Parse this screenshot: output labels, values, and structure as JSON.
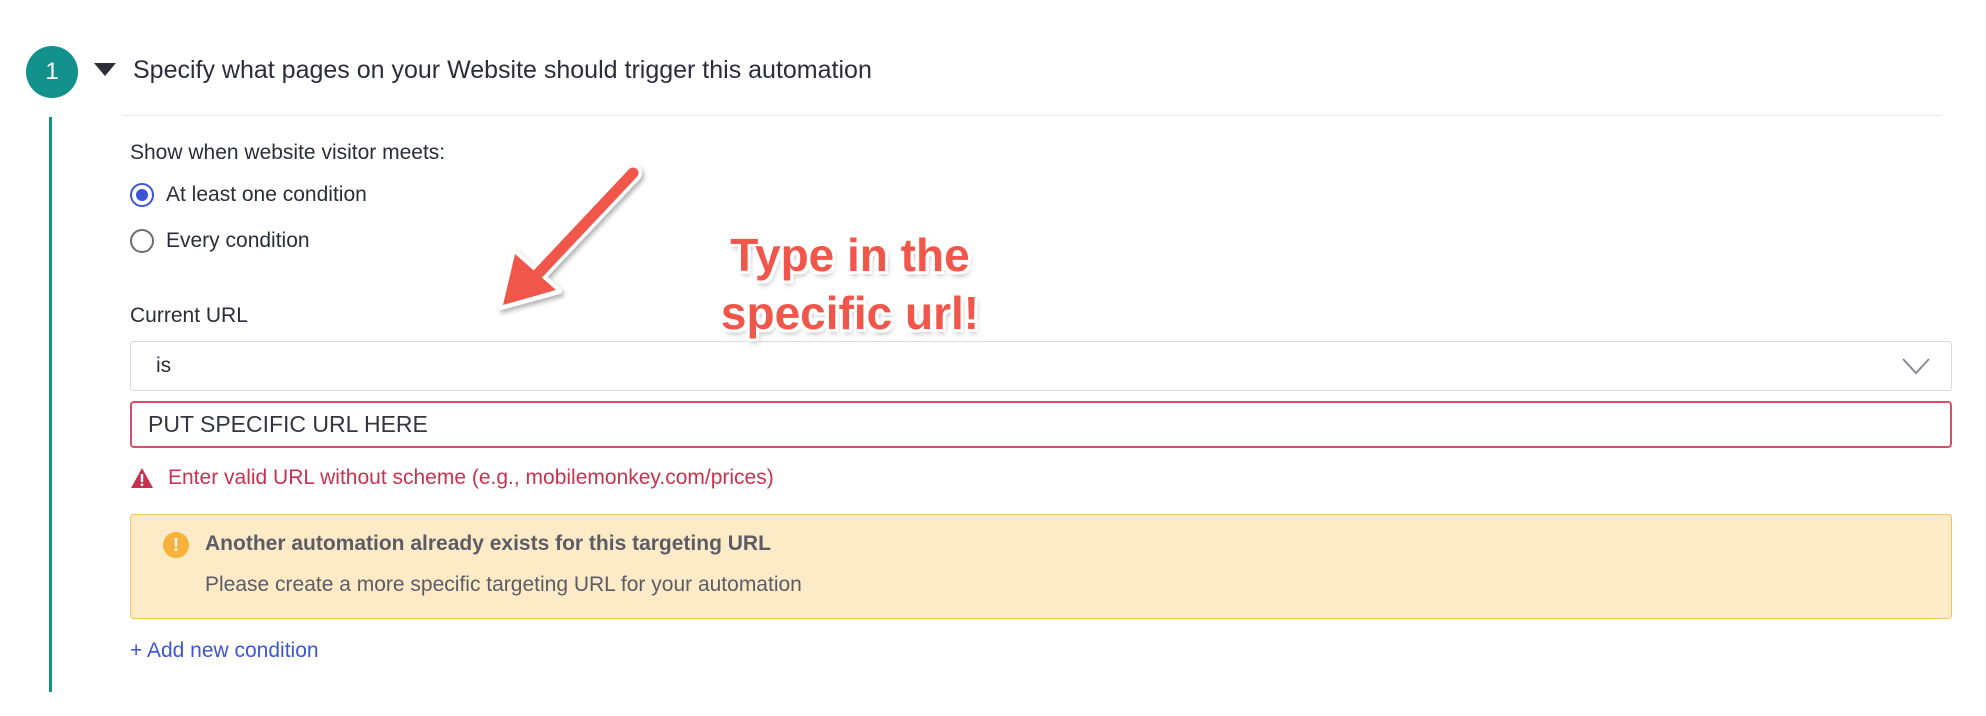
{
  "step": {
    "number": "1",
    "title": "Specify what pages on your Website should trigger this automation"
  },
  "conditions": {
    "label": "Show when website visitor meets:",
    "options": [
      {
        "label": "At least one condition",
        "checked": true
      },
      {
        "label": "Every condition",
        "checked": false
      }
    ]
  },
  "url_rule": {
    "label": "Current URL",
    "operator": "is",
    "value": "PUT SPECIFIC URL HERE",
    "error": "Enter valid URL without scheme (e.g., mobilemonkey.com/prices)"
  },
  "warning": {
    "title": "Another automation already exists for this targeting URL",
    "body": "Please create a more specific targeting URL for your automation"
  },
  "add_condition_label": "+ Add new condition",
  "annotation": {
    "line1": "Type in the",
    "line2": "specific url!"
  },
  "colors": {
    "accent_teal": "#12918c",
    "link_blue": "#3d56d6",
    "error_red": "#c7334f",
    "warning_bg": "#fdebc8",
    "annotation_red": "#f0564a"
  }
}
